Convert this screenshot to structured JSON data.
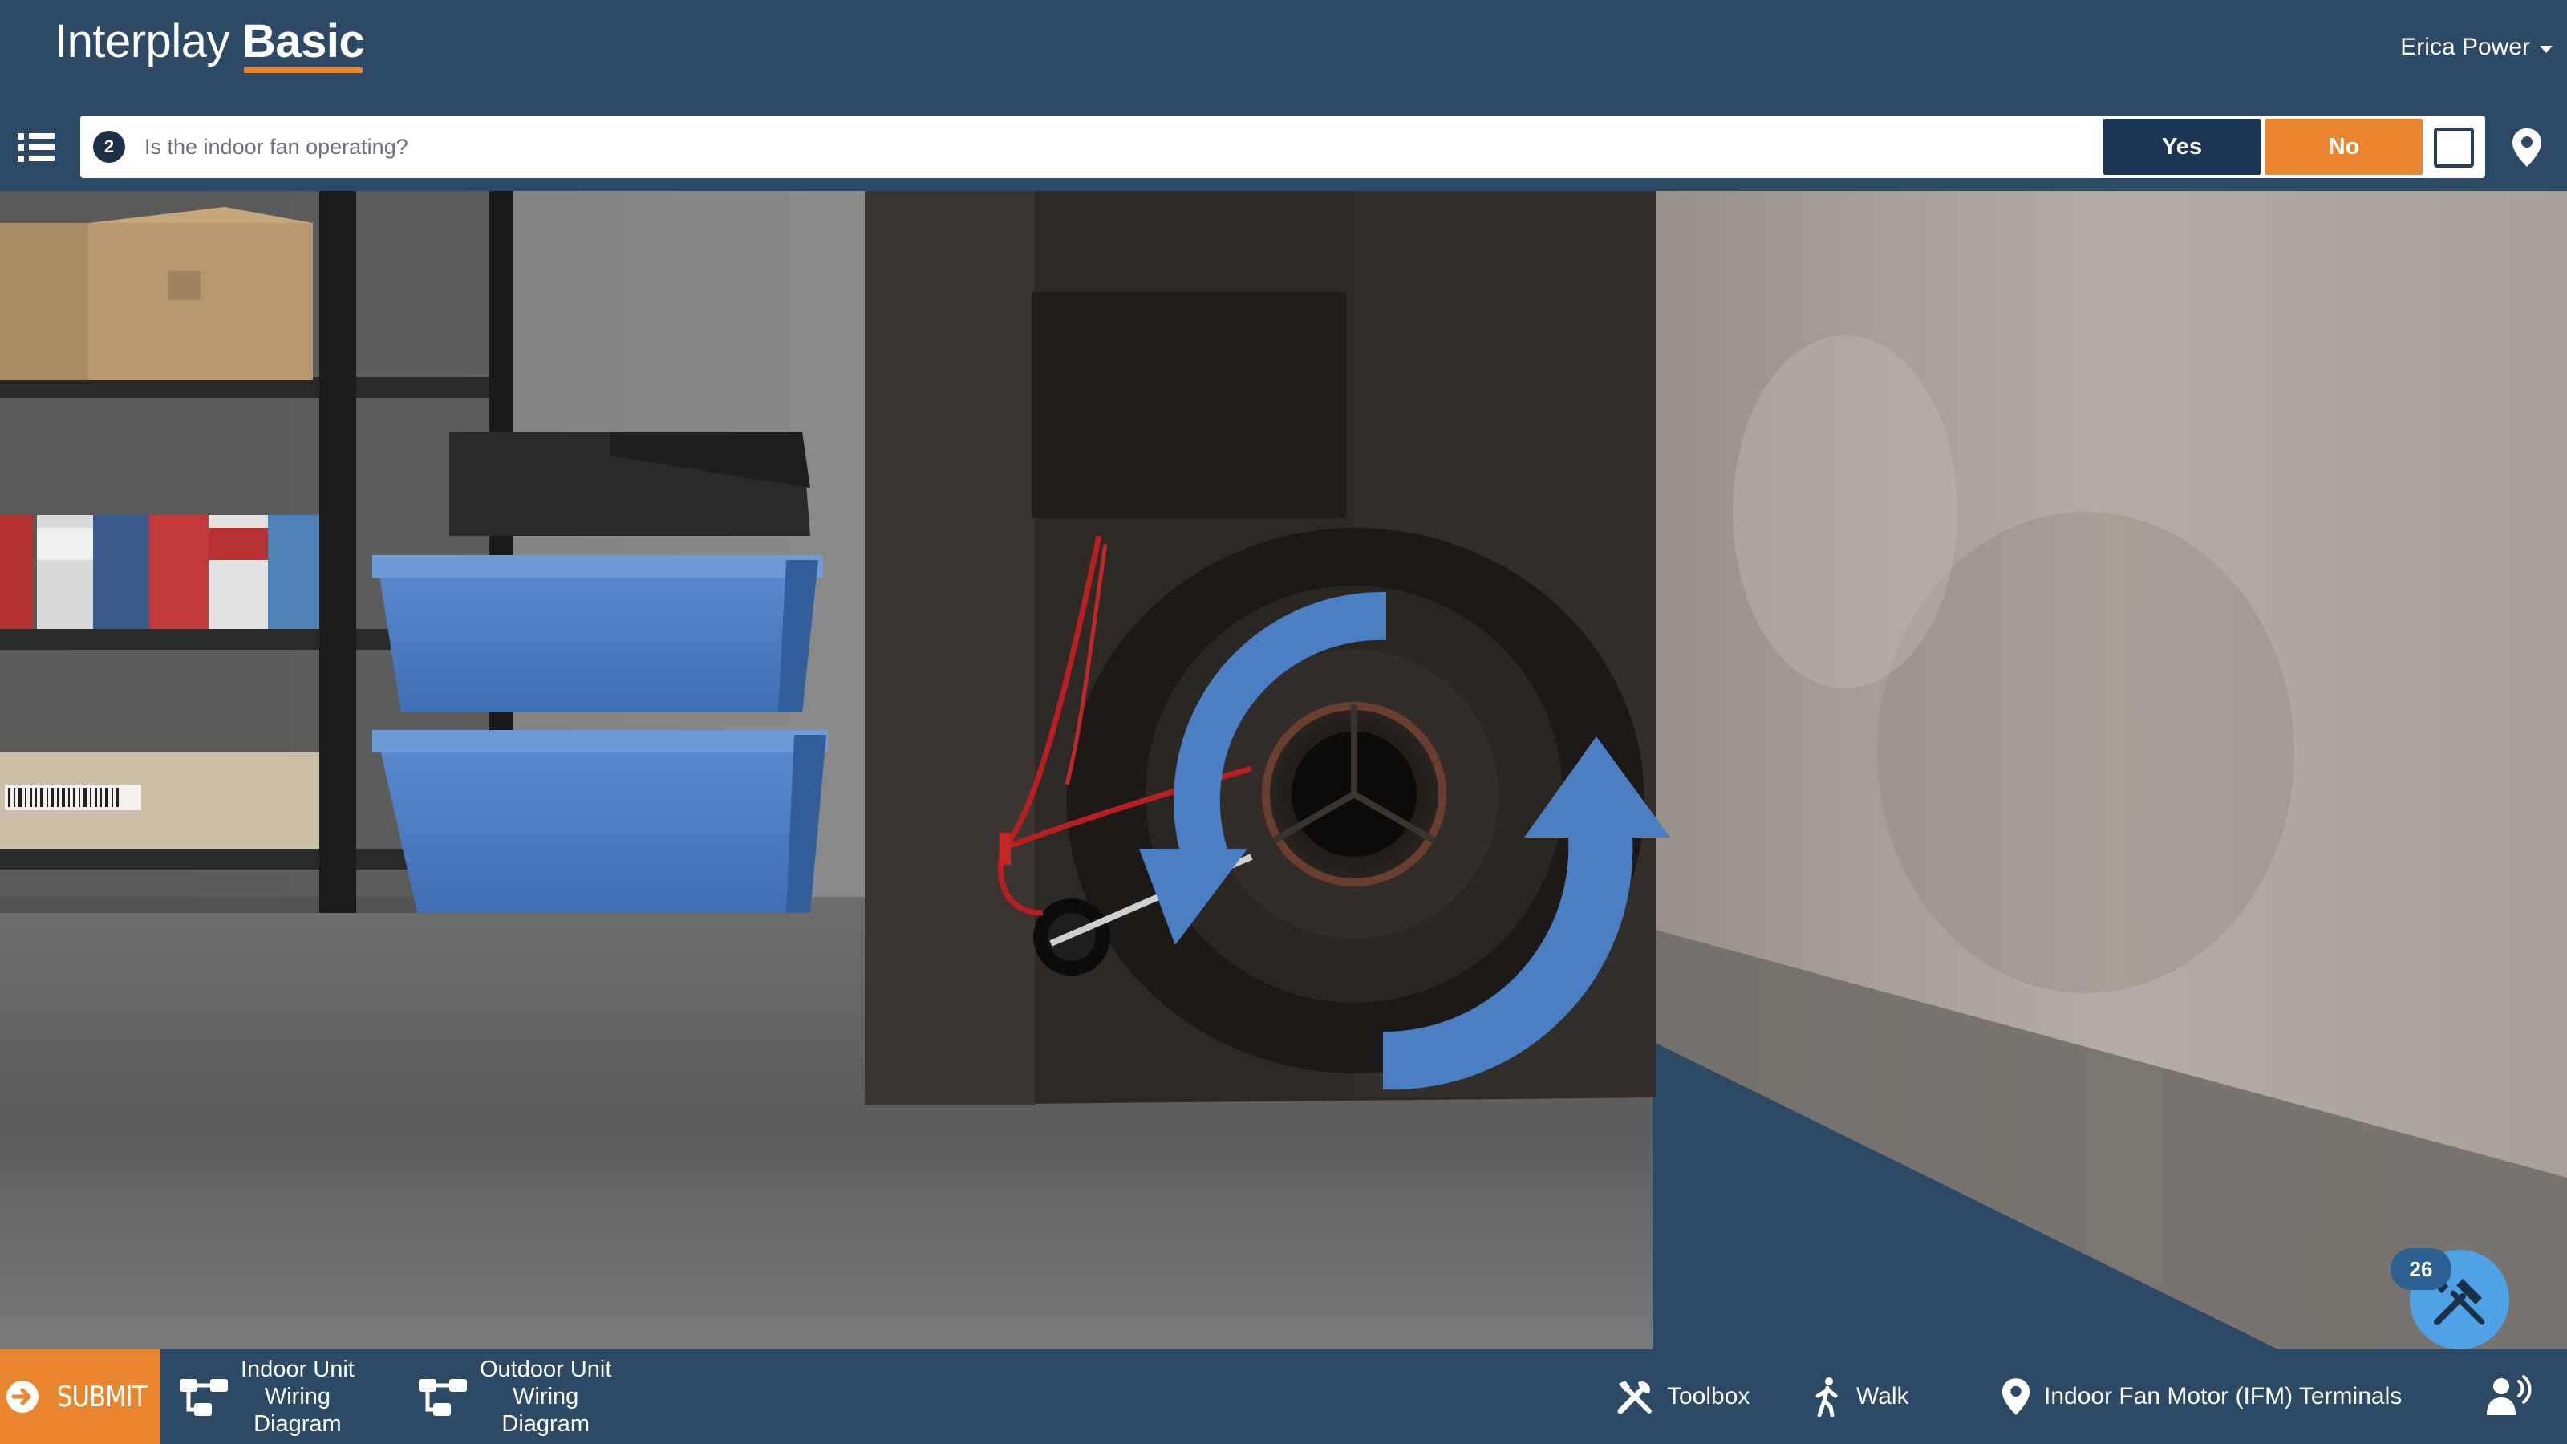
{
  "header": {
    "brand_light": "Interplay",
    "brand_bold": "Basic",
    "user_name": "Erica Power"
  },
  "question": {
    "number": "2",
    "text": "Is the indoor fan operating?",
    "yes_label": "Yes",
    "no_label": "No"
  },
  "tools": {
    "badge_count": "26"
  },
  "bottom": {
    "submit_label": "SUBMIT",
    "indoor_diagram": [
      "Indoor Unit",
      "Wiring",
      "Diagram"
    ],
    "outdoor_diagram": [
      "Outdoor Unit",
      "Wiring",
      "Diagram"
    ],
    "toolbox_label": "Toolbox",
    "walk_label": "Walk",
    "location_label": "Indoor Fan Motor (IFM) Terminals"
  },
  "colors": {
    "bar_bg": "#2c4a66",
    "accent_orange": "#e8852e",
    "yes_navy": "#1c3456",
    "fab_blue": "#4fa2e6",
    "rotation_arrow_blue": "#4a7fc4"
  },
  "icons": {
    "menu": "list-icon",
    "location": "map-pin-icon",
    "tools": "crossed-tools-icon",
    "submit": "arrow-circle-icon",
    "diagram": "diagram-icon",
    "toolbox": "wrench-screwdriver-icon",
    "walk": "walking-person-icon",
    "voice": "speaking-person-icon"
  }
}
